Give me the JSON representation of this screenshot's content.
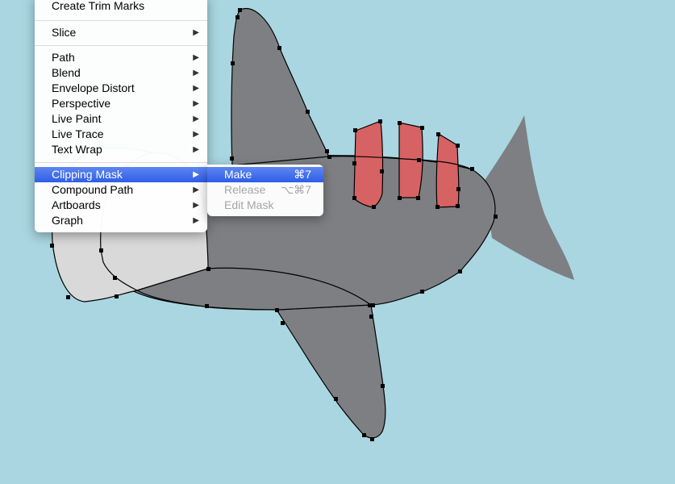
{
  "canvas": {
    "background_color": "#a9d6e1",
    "artwork": {
      "subject": "shark",
      "body_color": "#7e7f83",
      "gill_color": "#d66264",
      "selected_shape_color": "#d9d9d9",
      "anchor_color": "#000000"
    }
  },
  "object_menu": {
    "items": [
      {
        "label": "Create Trim Marks",
        "has_submenu": false
      },
      {
        "label": "Slice",
        "has_submenu": true
      },
      {
        "label": "Path",
        "has_submenu": true
      },
      {
        "label": "Blend",
        "has_submenu": true
      },
      {
        "label": "Envelope Distort",
        "has_submenu": true
      },
      {
        "label": "Perspective",
        "has_submenu": true
      },
      {
        "label": "Live Paint",
        "has_submenu": true
      },
      {
        "label": "Live Trace",
        "has_submenu": true
      },
      {
        "label": "Text Wrap",
        "has_submenu": true
      },
      {
        "label": "Clipping Mask",
        "has_submenu": true,
        "highlighted": true
      },
      {
        "label": "Compound Path",
        "has_submenu": true
      },
      {
        "label": "Artboards",
        "has_submenu": true
      },
      {
        "label": "Graph",
        "has_submenu": true
      }
    ],
    "submenu_arrow": "▶"
  },
  "clipping_mask_submenu": {
    "items": [
      {
        "label": "Make",
        "shortcut": "⌘7",
        "enabled": true,
        "highlighted": true
      },
      {
        "label": "Release",
        "shortcut": "⌥⌘7",
        "enabled": false
      },
      {
        "label": "Edit Mask",
        "shortcut": "",
        "enabled": false
      }
    ]
  },
  "colors": {
    "highlight": "#3a6aec",
    "disabled_text": "#a6a6a6"
  }
}
